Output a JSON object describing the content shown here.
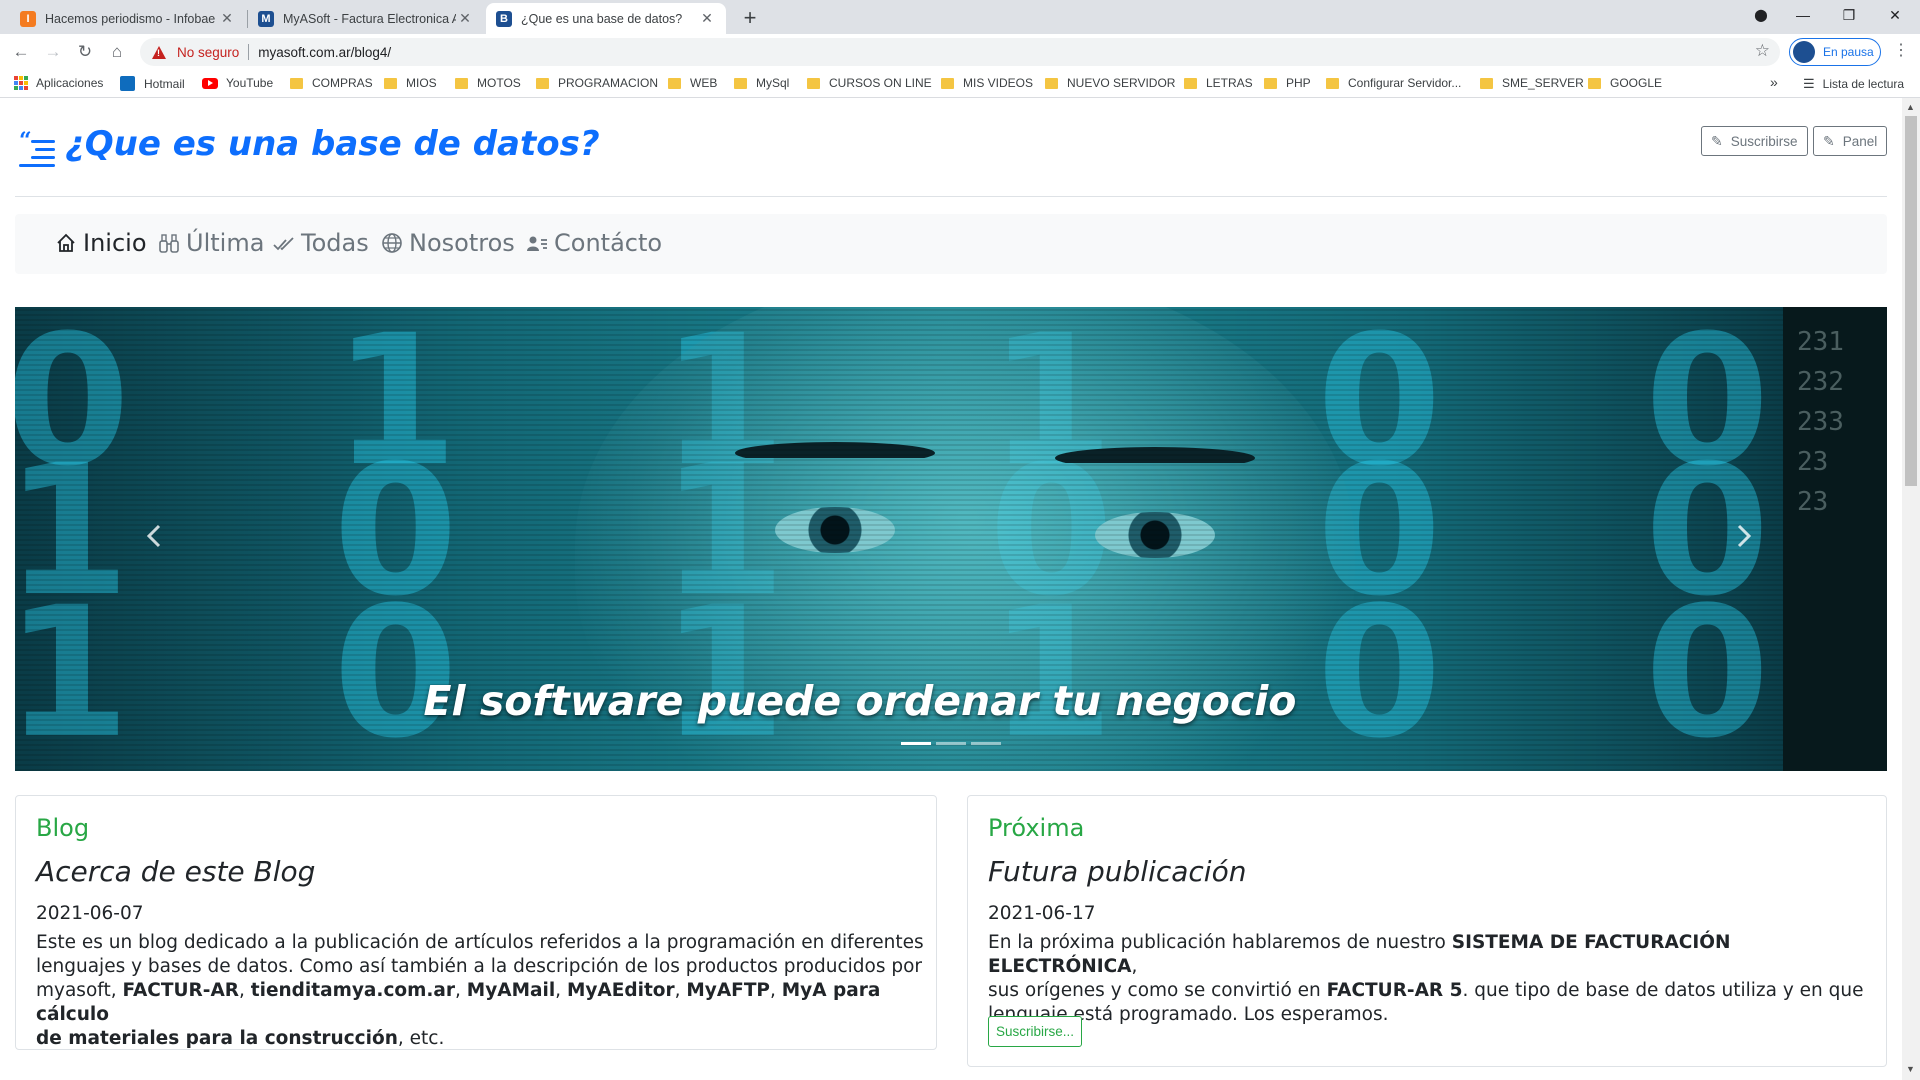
{
  "browser": {
    "tabs": [
      {
        "title": "Hacemos periodismo - Infobae",
        "icon": "infobae-favicon",
        "color": "#f47b20",
        "glyph": "I"
      },
      {
        "title": "MyASoft - Factura Electronica AF",
        "icon": "myasoft-favicon",
        "color": "#1d4f91",
        "glyph": "M"
      },
      {
        "title": "¿Que es una base de datos?",
        "icon": "blogger-favicon",
        "color": "#1d4f91",
        "glyph": "B"
      }
    ],
    "url": "myasoft.com.ar/blog4/",
    "security_label": "No seguro",
    "profile_label": "En pausa",
    "bookmarks": [
      "Aplicaciones",
      "Hotmail",
      "YouTube",
      "COMPRAS",
      "MIOS",
      "MOTOS",
      "PROGRAMACION",
      "WEB",
      "MySql",
      "CURSOS ON LINE",
      "MIS VIDEOS",
      "NUEVO SERVIDOR",
      "LETRAS",
      "PHP",
      "Configurar Servidor...",
      "SME_SERVER",
      "GOOGLE"
    ],
    "more_bookmarks": "»",
    "reading_list": "Lista de lectura"
  },
  "header": {
    "title": "¿Que es una base de datos?",
    "subscribe_label": "Suscribirse",
    "panel_label": "Panel"
  },
  "nav": {
    "items": [
      {
        "label": "Inicio",
        "icon": "home-icon",
        "active": true
      },
      {
        "label": "Última",
        "icon": "binoculars-icon",
        "active": false
      },
      {
        "label": "Todas",
        "icon": "check-all-icon",
        "active": false
      },
      {
        "label": "Nosotros",
        "icon": "globe-icon",
        "active": false
      },
      {
        "label": "Contácto",
        "icon": "person-lines-icon",
        "active": false
      }
    ]
  },
  "carousel": {
    "caption": "El software puede ordenar tu negocio",
    "prev_icon": "chevron-left-icon",
    "next_icon": "chevron-right-icon",
    "slide_count": 3,
    "active_slide": 1
  },
  "cards": [
    {
      "category": "Blog",
      "title": "Acerca de este Blog",
      "date": "2021-06-07",
      "text_1": "Este es un blog dedicado a la publicación de artículos referidos a la programación en diferentes",
      "text_2": "lenguajes y bases de datos. Como así también a la descripción de los productos producidos por",
      "text_3a": "myasoft, ",
      "text_3b": "FACTUR-AR",
      "text_3c": ", ",
      "text_3d": "tienditamya.com.ar",
      "text_3e": ", ",
      "text_3f": "MyAMail",
      "text_3g": ", ",
      "text_3h": "MyAEditor",
      "text_3i": ", ",
      "text_3j": "MyAFTP",
      "text_3k": ", ",
      "text_3l": "MyA para cálculo",
      "text_4a": "de materiales para la construcción",
      "text_4b": ", etc."
    },
    {
      "category": "Próxima",
      "title": "Futura publicación",
      "date": "2021-06-17",
      "text_1a": "En la próxima publicación hablaremos de nuestro ",
      "text_1b": "SISTEMA DE FACTURACIÓN ELECTRÓNICA",
      "text_1c": ",",
      "text_2a": "sus orígenes y como se convirtió en ",
      "text_2b": "FACTUR-AR 5",
      "text_2c": ". que tipo de base de datos utiliza y en que",
      "text_3": "lenguaje está programado. Los esperamos.",
      "button_label": "Suscribirse..."
    }
  ]
}
